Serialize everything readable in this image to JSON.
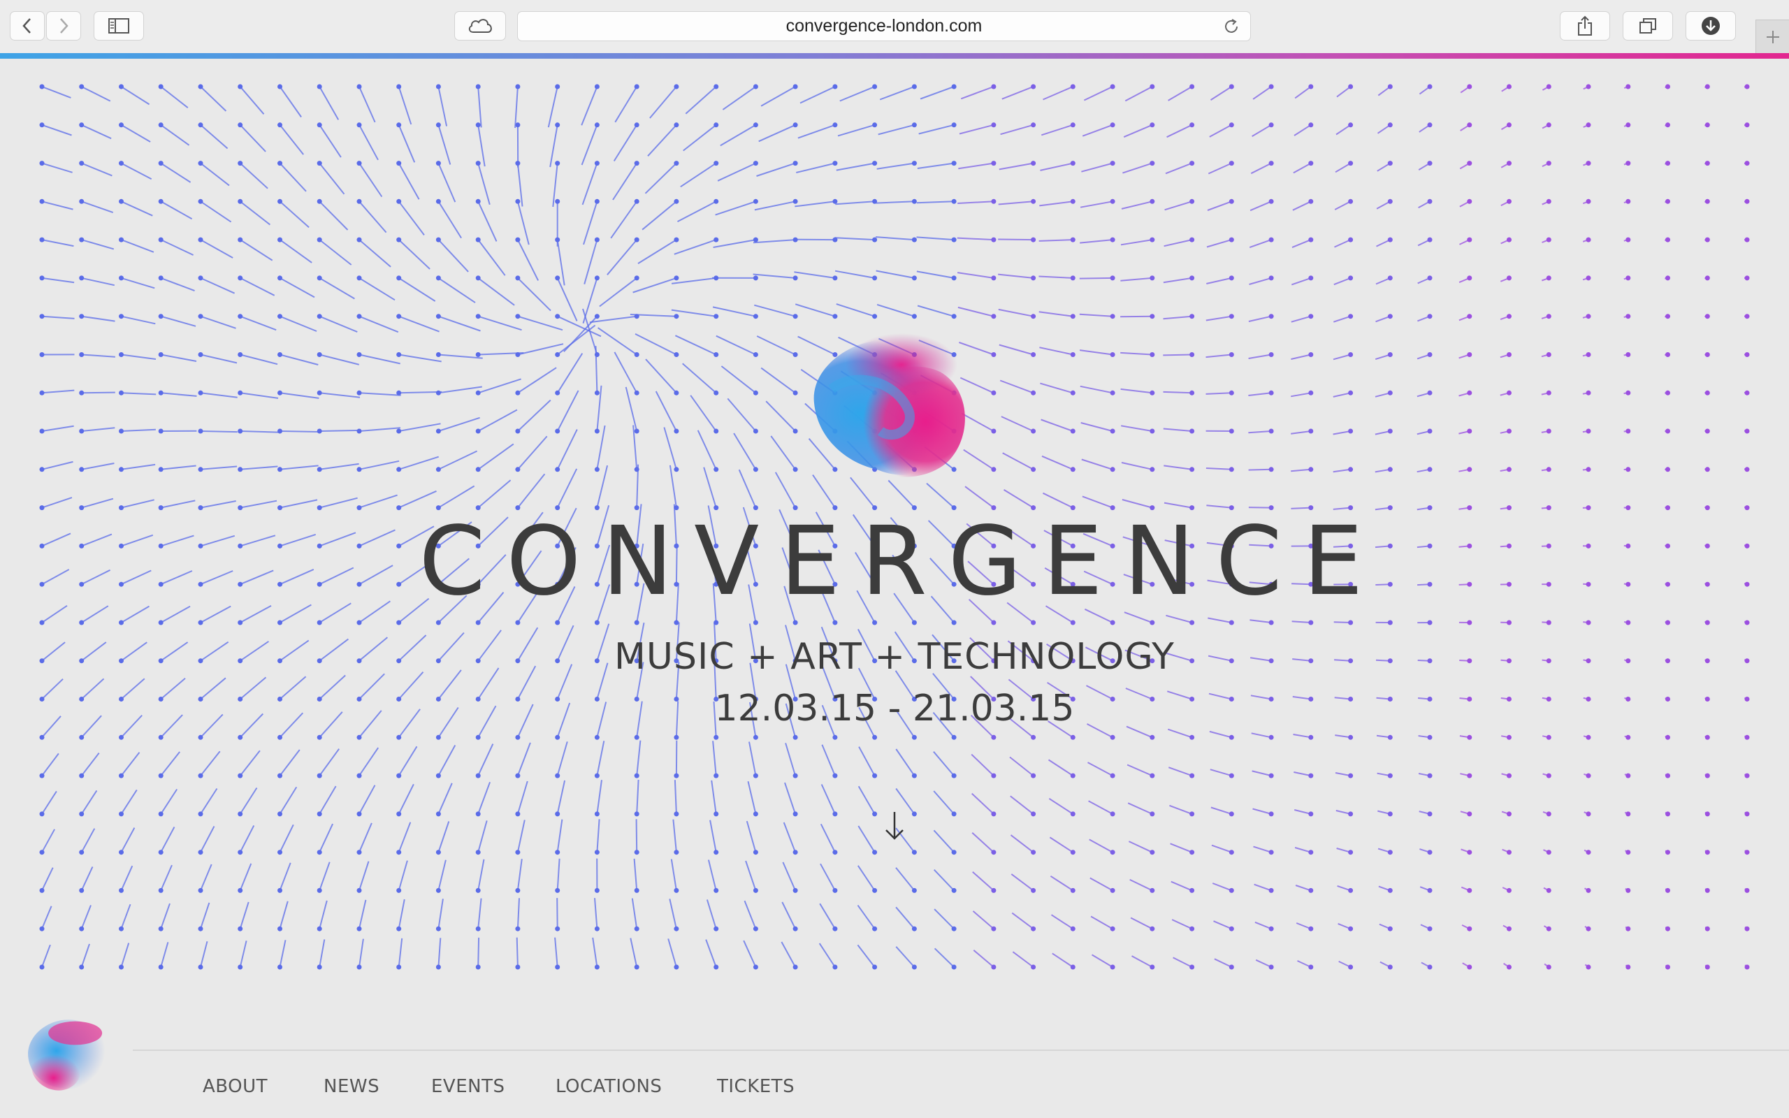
{
  "browser": {
    "url": "convergence-london.com",
    "icons": {
      "back": "chevron-left-icon",
      "forward": "chevron-right-icon",
      "sidebar": "sidebar-icon",
      "icloud": "cloud-icon",
      "reload": "reload-icon",
      "share": "share-icon",
      "tabs": "tabs-icon",
      "downloads": "download-icon",
      "new_tab": "plus-icon"
    },
    "progress_colors": [
      "#3ea3e6",
      "#7f7fd6",
      "#c44fb4",
      "#e2268f"
    ]
  },
  "hero": {
    "title": "CONVERGENCE",
    "tagline": "MUSIC + ART + TECHNOLOGY",
    "dates": "12.03.15 - 21.03.15",
    "scroll_icon": "arrow-down-icon",
    "field_colors": [
      "#5a6be8",
      "#7a5fe6",
      "#9b4fe0"
    ],
    "logo_colors": [
      "#2fa6ea",
      "#e81e8c"
    ]
  },
  "nav": {
    "items": [
      {
        "label": "ABOUT"
      },
      {
        "label": "NEWS"
      },
      {
        "label": "EVENTS"
      },
      {
        "label": "LOCATIONS"
      },
      {
        "label": "TICKETS"
      }
    ]
  }
}
